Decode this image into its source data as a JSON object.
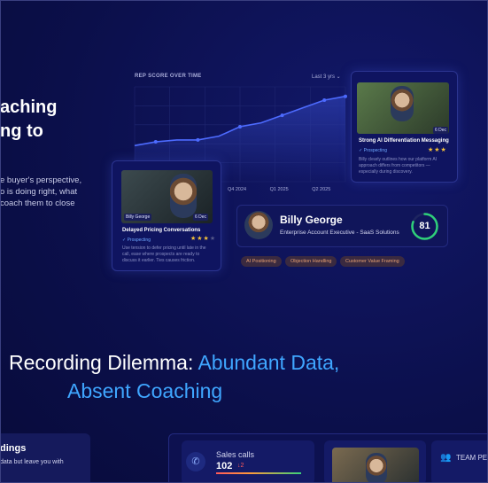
{
  "hero": {
    "line1": "aching",
    "line2": "ng to",
    "description": "e buyer's perspective, o is doing right, what coach them to close"
  },
  "chart": {
    "title": "REP SCORE OVER TIME",
    "period": "Last 3 yrs ⌄",
    "x_ticks": [
      "Q4 2024",
      "Q1 2025",
      "Q2 2025"
    ]
  },
  "chart_data": {
    "type": "area",
    "title": "REP SCORE OVER TIME",
    "categories": [
      "",
      "",
      "",
      "",
      "",
      "",
      "",
      "",
      "",
      "",
      ""
    ],
    "x_tick_labels": [
      "Q4 2024",
      "Q1 2025",
      "Q2 2025"
    ],
    "series": [
      {
        "values": [
          38,
          42,
          44,
          44,
          48,
          58,
          62,
          70,
          78,
          86,
          90
        ]
      }
    ],
    "ylim": [
      0,
      100
    ],
    "grid": true,
    "colors": {
      "line": "#4d6bff",
      "fill": "#2a3aa8"
    }
  },
  "card_left": {
    "name_chip": "Billy George",
    "duration_chip": "6 Dec",
    "title": "Delayed Pricing Conversations",
    "tag": "✓ Prospecting",
    "rating": 3,
    "rating_max": 4,
    "text": "Use tension to defer pricing until late in the call, ease where prospects are ready to discuss it earlier. Ties causes friction."
  },
  "card_right": {
    "duration_chip": "6 Dec",
    "title": "Strong AI Differentiation Messaging",
    "tag": "✓ Prospecting",
    "rating": 3,
    "rating_max": 3,
    "text": "Billy clearly outlines how our platform AI approach differs from competitors — especially during discovery."
  },
  "profile": {
    "name": "Billy George",
    "role": "Enterprise Account Executive - SaaS Solutions",
    "score": "81",
    "score_fraction": 0.81
  },
  "skills": [
    "AI Positioning",
    "Objection Handling",
    "Customer Value Framing"
  ],
  "headline": {
    "part1": "Recording Dilemma: ",
    "part1_accent": "Abundant Data,",
    "part2": "Absent Coaching"
  },
  "bottom_left": {
    "title": "dings",
    "text": "data but leave you with"
  },
  "dashboard": {
    "sales_label": "Sales calls",
    "sales_value": "102",
    "sales_delta": "↓2",
    "team_label": "TEAM PE"
  },
  "icons": {
    "phone": "phone-icon",
    "team": "team-icon",
    "star": "star-icon"
  }
}
